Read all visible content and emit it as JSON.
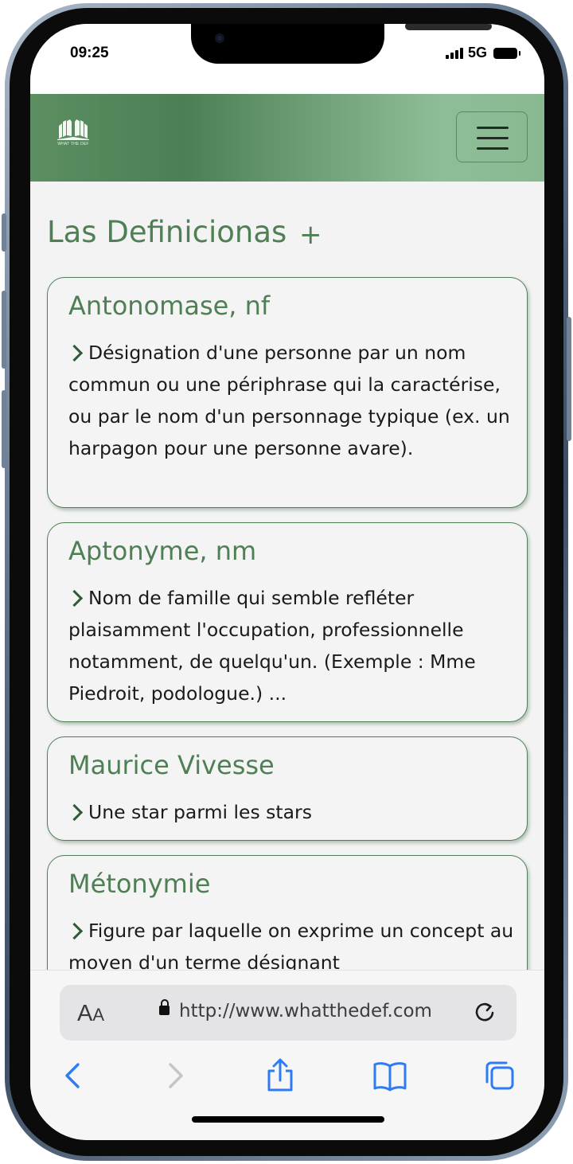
{
  "status_bar": {
    "time": "09:25",
    "network": "5G"
  },
  "header": {
    "logo_text": "WHAT THE DEF",
    "menu_icon": "hamburger-icon"
  },
  "page": {
    "title": "Las Definicionas",
    "add_label": "+"
  },
  "definitions": [
    {
      "term": "Antonomase, nf",
      "text": "Désignation d'une personne par un nom commun ou une périphrase qui la caractérise, ou par le nom d'un personnage typique (ex. un harpagon pour une personne avare)."
    },
    {
      "term": "Aptonyme, nm",
      "text": "Nom de famille qui semble refléter plaisamment l'occupation, professionnelle notamment, de quelqu'un. (Exemple : Mme Piedroit, podologue.) ..."
    },
    {
      "term": "Maurice Vivesse",
      "text": "Une star parmi les stars"
    },
    {
      "term": "Métonymie",
      "text": "Figure par laquelle on exprime un concept au moyen d'un terme désignant"
    }
  ],
  "browser": {
    "text_size_big": "A",
    "text_size_small": "A",
    "url": "http://www.whatthedef.com",
    "icons": [
      "back-icon",
      "forward-icon",
      "share-icon",
      "bookmarks-icon",
      "tabs-icon",
      "reload-icon",
      "lock-icon"
    ]
  },
  "colors": {
    "accent": "#4f7f55",
    "header_start": "#5c8e62",
    "header_end": "#8ab891",
    "background": "#f3f3f3"
  }
}
